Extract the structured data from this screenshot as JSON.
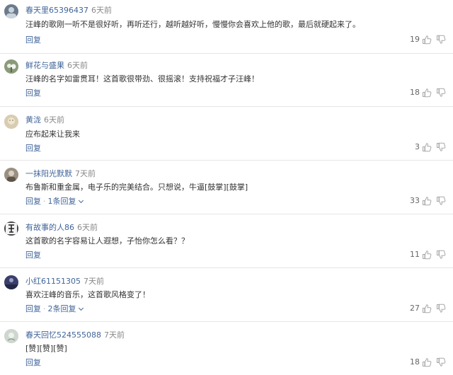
{
  "comments": [
    {
      "username": "春天里65396437",
      "time": "6天前",
      "content": "汪峰的歌刚一听不是很好听，再听还行，越听越好听，慢慢你会喜欢上他的歌，最后就硬起来了。",
      "reply_label": "回复",
      "replies_label": "",
      "likes": "19",
      "avatar_color": "#6b7b8c"
    },
    {
      "username": "鲜花与盛果",
      "time": "6天前",
      "content": "汪峰的名字如雷贯耳！这首歌很带劲、很摇滚！支持祝福才子汪峰！",
      "reply_label": "回复",
      "replies_label": "",
      "likes": "18",
      "avatar_color": "#8a9a7a"
    },
    {
      "username": "黄泷",
      "time": "6天前",
      "content": "应布起来让我来",
      "reply_label": "回复",
      "replies_label": "",
      "likes": "3",
      "avatar_color": "#d8cdb0"
    },
    {
      "username": "一抹阳光默默",
      "time": "7天前",
      "content": "布鲁斯和重金属，电子乐的完美结合。只想说，牛逼[鼓掌][鼓掌]",
      "reply_label": "回复",
      "replies_label": "1条回复",
      "likes": "33",
      "avatar_color": "#9a8f80"
    },
    {
      "username": "有故事的人86",
      "time": "6天前",
      "content": "这首歌的名字容易让人遐想，子怡你怎么看？？",
      "reply_label": "回复",
      "replies_label": "",
      "likes": "11",
      "avatar_color": "#444444"
    },
    {
      "username": "小红61151305",
      "time": "7天前",
      "content": "喜欢汪峰的音乐，这首歌风格变了！",
      "reply_label": "回复",
      "replies_label": "2条回复",
      "likes": "27",
      "avatar_color": "#3a3f6a"
    },
    {
      "username": "春天回忆524555088",
      "time": "7天前",
      "content": "[赞][赞][赞]",
      "reply_label": "回复",
      "replies_label": "",
      "likes": "18",
      "avatar_color": "#cfd6cf"
    }
  ]
}
